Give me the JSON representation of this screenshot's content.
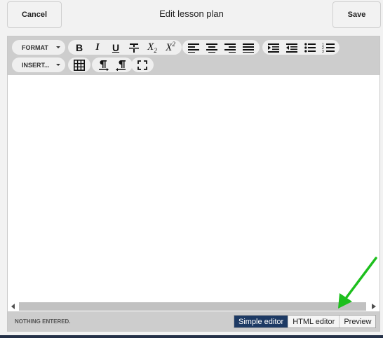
{
  "header": {
    "cancel_label": "Cancel",
    "title": "Edit lesson plan",
    "save_label": "Save"
  },
  "toolbar": {
    "format_label": "FORMAT",
    "insert_label": "INSERT...",
    "bold": "B",
    "italic": "I",
    "underline": "U",
    "subscript": "X",
    "subscript_sub": "2",
    "superscript": "X",
    "superscript_sup": "2"
  },
  "status": {
    "text": "NOTHING ENTERED."
  },
  "modes": {
    "items": [
      "Simple editor",
      "HTML editor",
      "Preview"
    ],
    "active": "Simple editor"
  },
  "colors": {
    "active_mode": "#1d3a64",
    "annotation_arrow": "#1dbf1d",
    "toolbar_bg": "#cdcdcd"
  }
}
